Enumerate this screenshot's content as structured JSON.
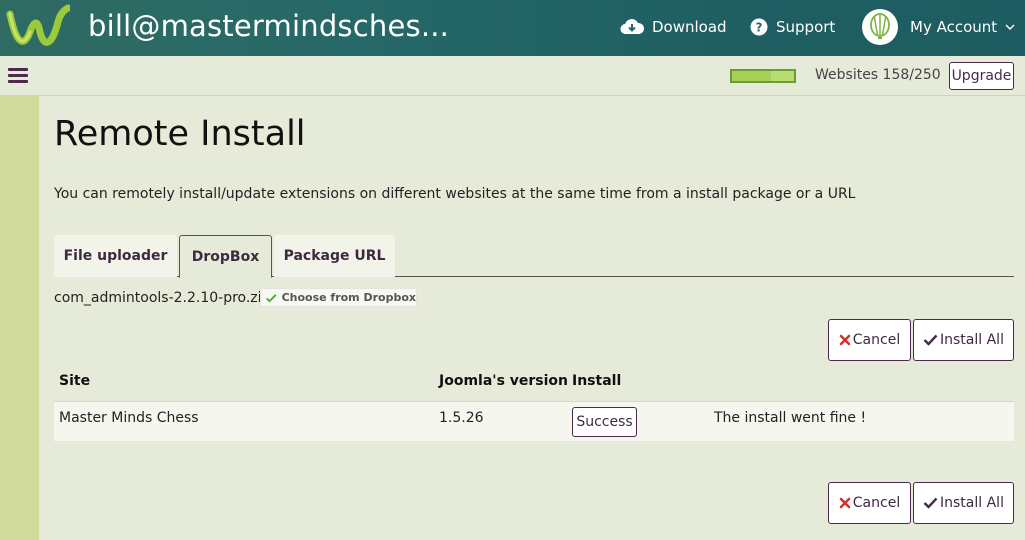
{
  "header": {
    "title": "bill@mastermindsches...",
    "download_label": "Download",
    "support_label": "Support",
    "account_label": "My Account"
  },
  "subbar": {
    "websites_label": "Websites 158/250",
    "websites_used": 158,
    "websites_total": 250,
    "upgrade_label": "Upgrade"
  },
  "page": {
    "title": "Remote Install",
    "description": "You can remotely install/update extensions on different websites at the same time from a install package or a URL"
  },
  "tabs": [
    {
      "label": "File uploader",
      "active": false
    },
    {
      "label": "DropBox",
      "active": true
    },
    {
      "label": "Package URL",
      "active": false
    }
  ],
  "dropbox": {
    "filename": "com_admintools-2.2.10-pro.zip",
    "choose_label": "Choose from Dropbox"
  },
  "actions": {
    "cancel_label": "Cancel",
    "install_all_label": "Install All"
  },
  "table": {
    "headers": [
      "Site",
      "Joomla's version",
      "Install"
    ],
    "rows": [
      {
        "site": "Master Minds Chess",
        "version": "1.5.26",
        "install_status": "Success",
        "message": "The install went fine !"
      }
    ]
  },
  "colors": {
    "header_bg": "#266868",
    "accent": "#4b2a4c",
    "page_bg": "#e6ebd9",
    "progress_fill": "#a6d05a",
    "cancel_icon": "#d0342c",
    "check_icon": "#4b2a4c",
    "dropbox_check": "#4caf2a"
  }
}
